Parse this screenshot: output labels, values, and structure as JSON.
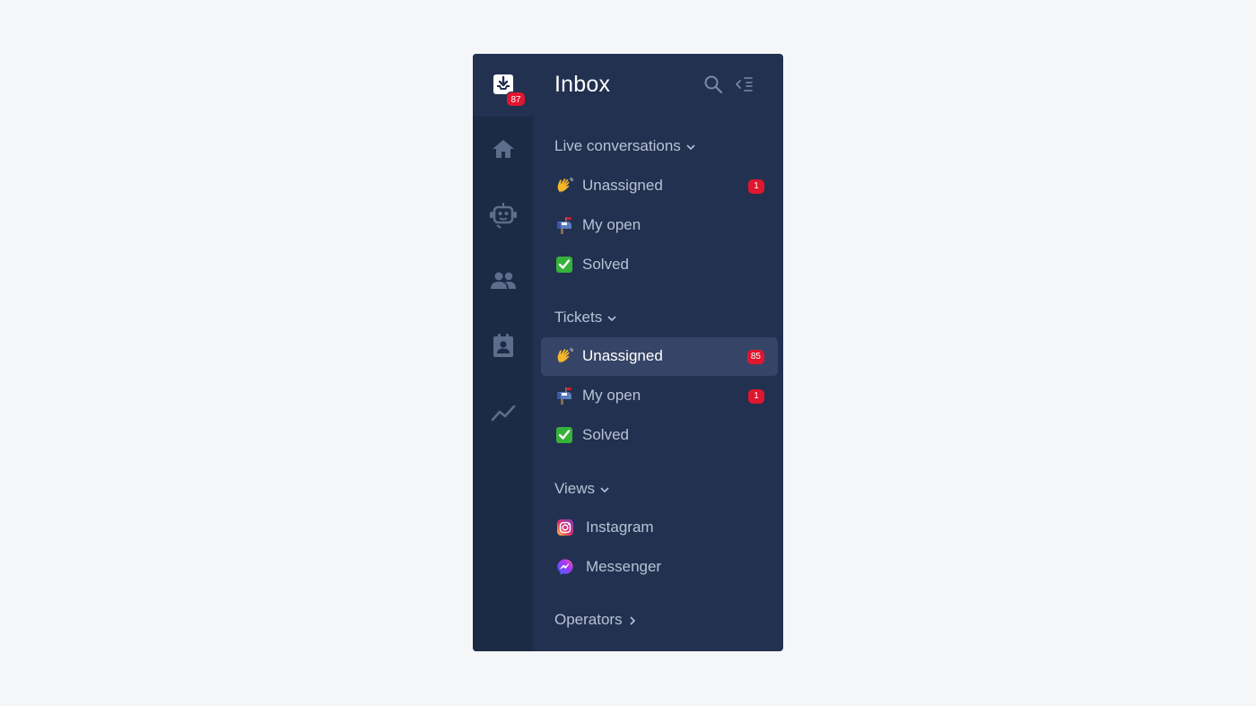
{
  "header": {
    "title": "Inbox",
    "inbox_badge": "87"
  },
  "rail": {
    "icons": [
      "inbox-icon",
      "home-icon",
      "bot-icon",
      "contacts-icon",
      "contact-card-icon",
      "analytics-icon"
    ]
  },
  "sections": {
    "live": {
      "label": "Live conversations",
      "items": [
        {
          "label": "Unassigned",
          "icon": "waving-hand-emoji",
          "badge": "1"
        },
        {
          "label": "My open",
          "icon": "mailbox-emoji",
          "badge": ""
        },
        {
          "label": "Solved",
          "icon": "check-mark-emoji",
          "badge": ""
        }
      ]
    },
    "tickets": {
      "label": "Tickets",
      "items": [
        {
          "label": "Unassigned",
          "icon": "waving-hand-emoji",
          "badge": "85",
          "active": true
        },
        {
          "label": "My open",
          "icon": "mailbox-emoji",
          "badge": "1"
        },
        {
          "label": "Solved",
          "icon": "check-mark-emoji",
          "badge": ""
        }
      ]
    },
    "views": {
      "label": "Views",
      "items": [
        {
          "label": "Instagram",
          "icon": "instagram-icon"
        },
        {
          "label": "Messenger",
          "icon": "messenger-icon"
        }
      ]
    },
    "operators": {
      "label": "Operators"
    }
  },
  "colors": {
    "page_bg": "#f5f6f8",
    "panel_bg": "#223150",
    "rail_bg": "#1c2a45",
    "active_item_bg": "#364567",
    "badge_red": "#e0162e",
    "muted_text": "#b8c2d6",
    "icon_muted": "#5d6d8c"
  }
}
